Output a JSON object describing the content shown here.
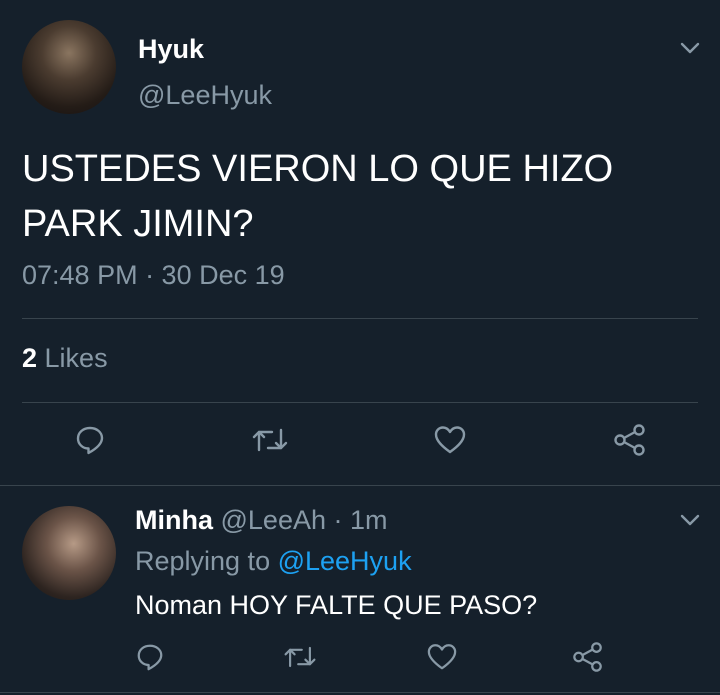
{
  "tweet": {
    "author_name": "Hyuk",
    "author_handle": "@LeeHyuk",
    "text": "USTEDES VIERON LO QUE HIZO PARK JIMIN?",
    "timestamp": "07:48 PM · 30 Dec 19",
    "likes_count": "2",
    "likes_label": " Likes",
    "actions": [
      "reply-icon",
      "retweet-icon",
      "like-icon",
      "share-icon"
    ]
  },
  "reply": {
    "author_name": "Minha",
    "meta": " @LeeAh · 1m",
    "replying_prefix": "Replying to ",
    "replying_mention": "@LeeHyuk",
    "text": "Noman HOY FALTE QUE PASO?",
    "actions": [
      "reply-icon",
      "retweet-icon",
      "like-icon",
      "share-icon"
    ]
  },
  "colors": {
    "background": "#15202b",
    "secondary_text": "#8899a6",
    "link": "#1da1f2",
    "divider": "#38444d"
  }
}
